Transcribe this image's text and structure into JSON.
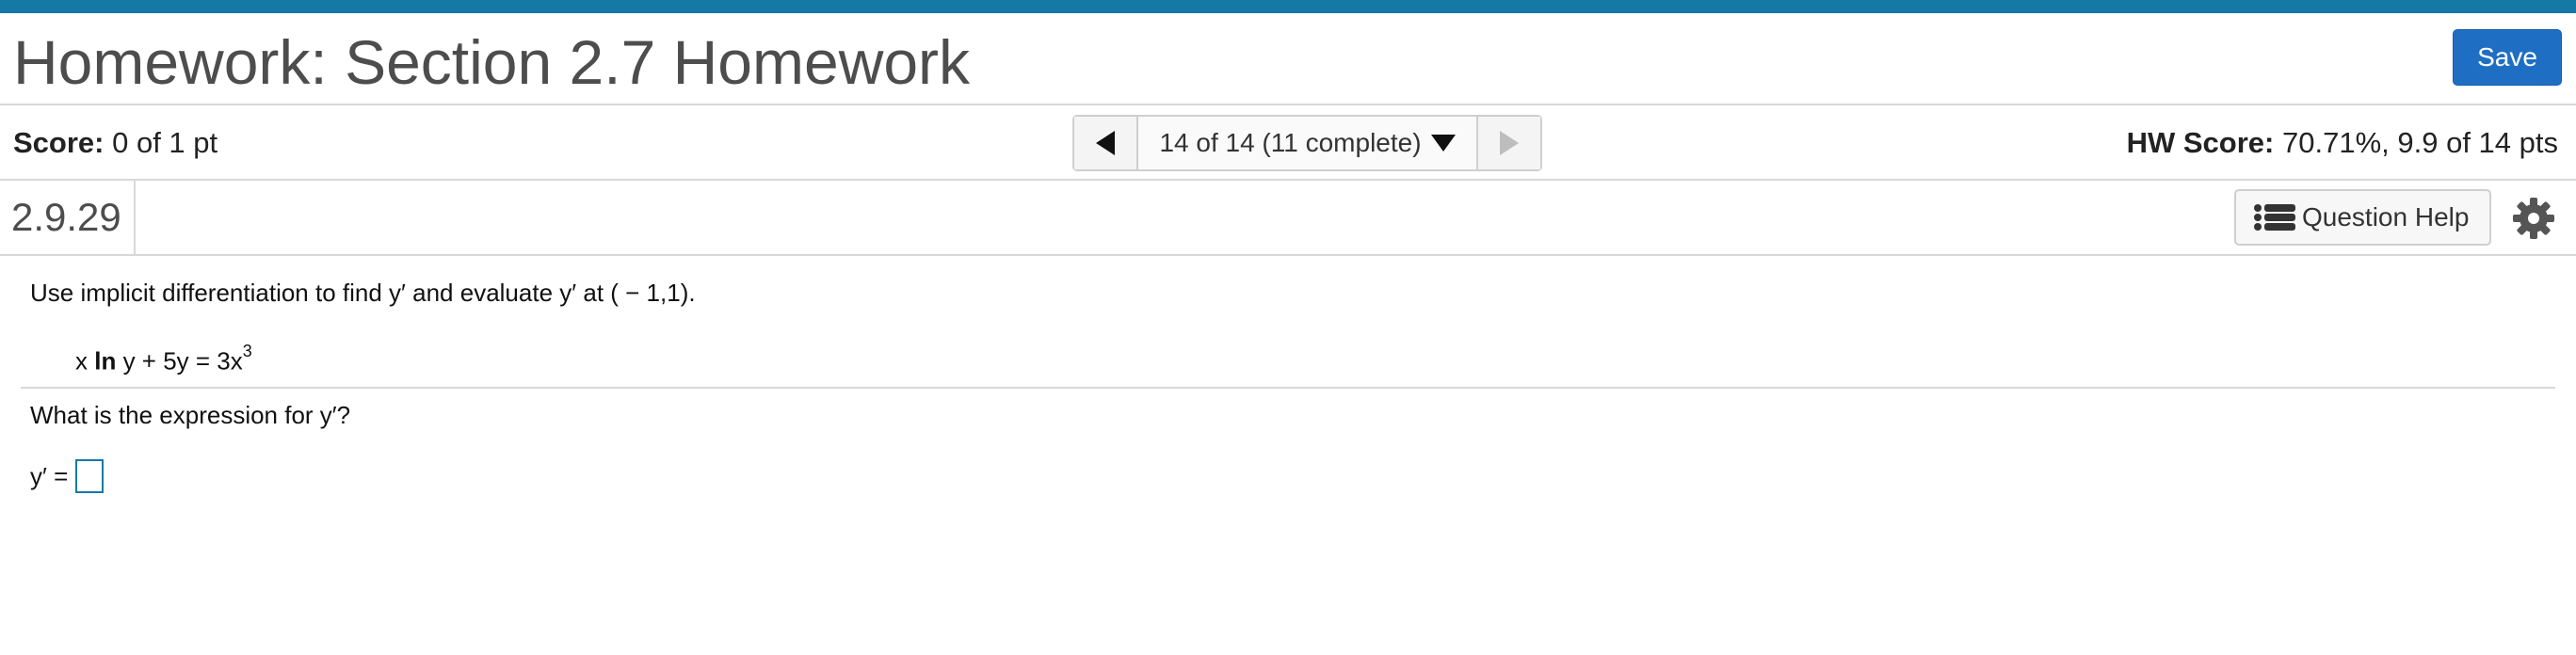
{
  "header": {
    "title": "Homework: Section 2.7 Homework",
    "save_label": "Save"
  },
  "score": {
    "label": "Score:",
    "value": "0 of 1 pt",
    "hw_label": "HW Score:",
    "hw_value": "70.71%, 9.9 of 14 pts"
  },
  "nav": {
    "current": "14 of 14 (11 complete)",
    "prev_icon": "triangle-left-icon",
    "next_icon": "triangle-right-icon",
    "dropdown_icon": "triangle-down-icon"
  },
  "question": {
    "number": "2.9.29",
    "help_label": "Question Help",
    "help_icon": "list-icon",
    "settings_icon": "gear-icon",
    "prompt": "Use implicit differentiation to find y′ and evaluate y′ at ( − 1,1).",
    "equation": {
      "part1": "x ",
      "ln": "ln",
      "part2": " y + 5y = 3x",
      "exponent": "3"
    },
    "subquestion": "What is the expression for y′?",
    "answer_label": "y′ =",
    "answer_value": ""
  },
  "colors": {
    "topbar": "#1479a5",
    "save_button": "#1e6fc4",
    "answer_border": "#1479a5"
  }
}
